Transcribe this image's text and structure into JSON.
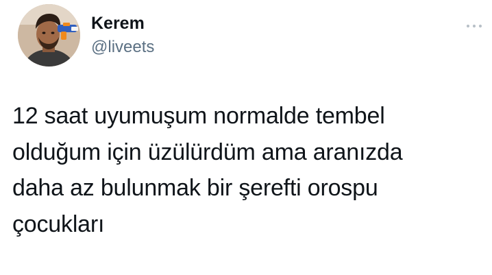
{
  "tweet": {
    "author": {
      "display_name": "Kerem",
      "handle": "@liveets",
      "avatar_icon": "profile-photo"
    },
    "menu_icon": "more-horizontal-icon",
    "text": "12 saat uyumuşum normalde tembel\nolduğum için üzülürdüm ama aranızda\ndaha az bulunmak bir şerefti orospu\nçocukları"
  },
  "colors": {
    "background": "#ffffff",
    "text_primary": "#0f1419",
    "text_secondary": "#5b7083",
    "menu_dots": "#b8c0c8"
  }
}
